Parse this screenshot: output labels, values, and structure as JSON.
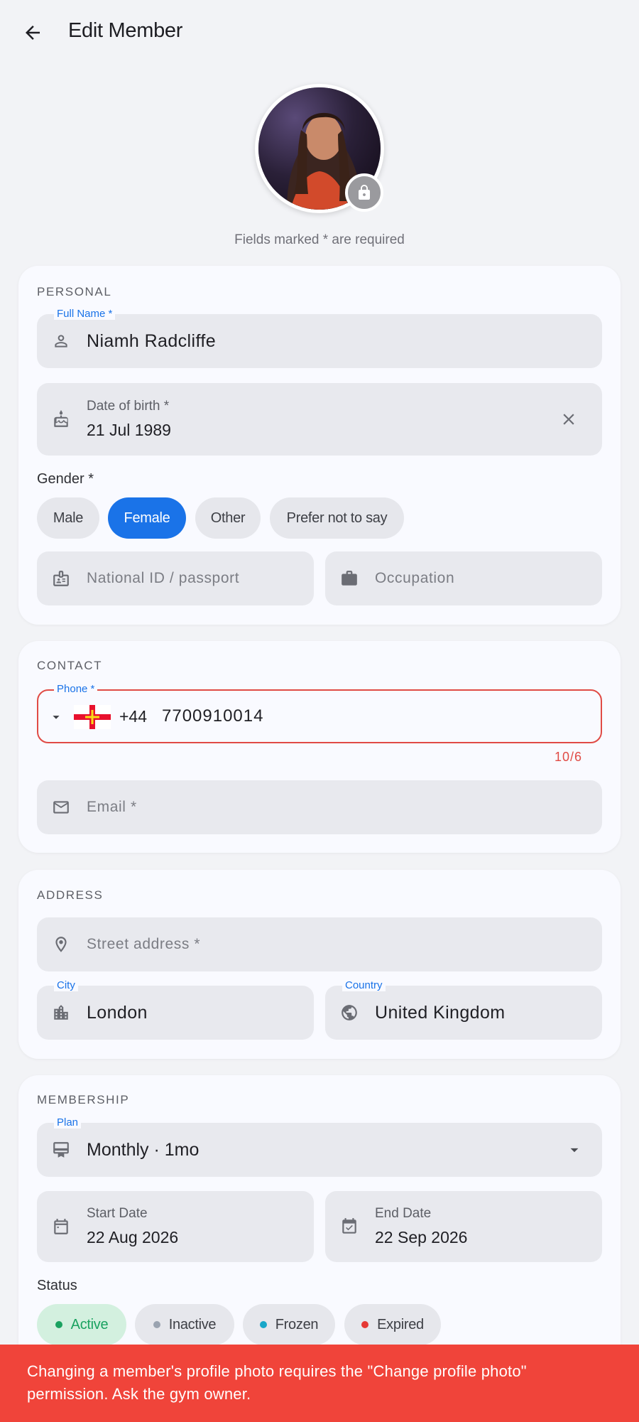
{
  "appbar": {
    "title": "Edit Member",
    "back_icon": "arrow-left-icon"
  },
  "avatar": {
    "lock_icon": "lock-icon"
  },
  "required_hint": "Fields marked * are required",
  "personal": {
    "title": "PERSONAL",
    "full_name": {
      "label": "Full Name *",
      "value": "Niamh Radcliffe",
      "icon": "person-icon"
    },
    "dob": {
      "label": "Date of birth *",
      "value": "21 Jul 1989",
      "icon": "cake-icon",
      "clear_icon": "close-icon"
    },
    "gender": {
      "label": "Gender *",
      "options": [
        "Male",
        "Female",
        "Other",
        "Prefer not to say"
      ],
      "selected": "Female"
    },
    "national_id": {
      "placeholder": "National ID / passport",
      "icon": "id-card-icon"
    },
    "occupation": {
      "placeholder": "Occupation",
      "icon": "briefcase-icon"
    }
  },
  "contact": {
    "title": "CONTACT",
    "phone": {
      "label": "Phone *",
      "dial_code": "+44",
      "value": "7700910014",
      "counter": "10/6",
      "flag": "guernsey-flag-icon"
    },
    "email": {
      "placeholder": "Email *",
      "icon": "mail-icon"
    }
  },
  "address": {
    "title": "ADDRESS",
    "street": {
      "placeholder": "Street address *",
      "icon": "location-pin-icon"
    },
    "city": {
      "label": "City",
      "value": "London",
      "icon": "city-icon"
    },
    "country": {
      "label": "Country",
      "value": "United Kingdom",
      "icon": "globe-icon"
    }
  },
  "membership": {
    "title": "MEMBERSHIP",
    "plan": {
      "label": "Plan",
      "value": "Monthly · 1mo",
      "icon": "card-membership-icon"
    },
    "start_date": {
      "label": "Start Date",
      "value": "22 Aug 2026",
      "icon": "calendar-icon"
    },
    "end_date": {
      "label": "End Date",
      "value": "22 Sep 2026",
      "icon": "calendar-check-icon"
    },
    "status": {
      "label": "Status",
      "options": [
        {
          "label": "Active",
          "color": "#1aa260"
        },
        {
          "label": "Inactive",
          "color": "#9aa3b0"
        },
        {
          "label": "Frozen",
          "color": "#18a7c9"
        },
        {
          "label": "Expired",
          "color": "#e53935"
        }
      ],
      "selected": "Active"
    }
  },
  "toast": {
    "message": "Changing a member's profile photo requires the \"Change profile photo\" permission. Ask the gym owner."
  },
  "colors": {
    "accent": "#1a73e8",
    "error": "#e53935",
    "toast_bg": "#f0443a"
  }
}
